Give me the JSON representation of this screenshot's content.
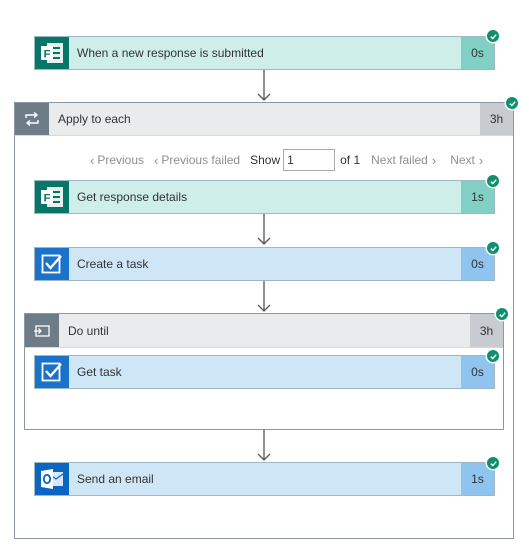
{
  "trigger": {
    "label": "When a new response is submitted",
    "duration": "0s",
    "icon": "forms-icon"
  },
  "apply_to_each": {
    "label": "Apply to each",
    "duration": "3h",
    "icon": "loop-icon",
    "pager": {
      "previous": "Previous",
      "previous_failed": "Previous failed",
      "show_label": "Show",
      "current_value": "1",
      "of_label": "of 1",
      "next_failed": "Next failed",
      "next": "Next"
    }
  },
  "steps": {
    "get_response": {
      "label": "Get response details",
      "duration": "1s",
      "icon": "forms-icon"
    },
    "create_task": {
      "label": "Create a task",
      "duration": "0s",
      "icon": "todo-check-icon"
    },
    "send_email": {
      "label": "Send an email",
      "duration": "1s",
      "icon": "outlook-icon"
    }
  },
  "do_until": {
    "label": "Do until",
    "duration": "3h",
    "icon": "do-until-icon",
    "get_task": {
      "label": "Get task",
      "duration": "0s",
      "icon": "todo-check-icon"
    }
  },
  "colors": {
    "success": "#0f8f6e",
    "forms_brand": "#077568",
    "todo_brand": "#1a72c9",
    "outlook_brand": "#0b66c2",
    "container_header": "#6e7c88"
  }
}
